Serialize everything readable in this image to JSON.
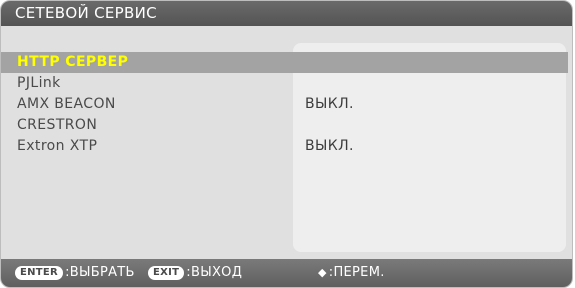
{
  "window": {
    "title": "СЕТЕВОЙ СЕРВИС"
  },
  "menu": {
    "items": [
      {
        "label": "HTTP СЕРВЕР",
        "value": "",
        "selected": true
      },
      {
        "label": "PJLink",
        "value": ""
      },
      {
        "label": "AMX BEACON",
        "value": "ВЫКЛ."
      },
      {
        "label": "CRESTRON",
        "value": ""
      },
      {
        "label": "Extron XTP",
        "value": "ВЫКЛ."
      }
    ]
  },
  "footer": {
    "enter_key": "ENTER",
    "enter_action": ":ВЫБРАТЬ",
    "exit_key": "EXIT",
    "exit_action": ":ВЫХОД",
    "move_icon": "up-down-arrows-icon",
    "move_action": ":ПЕРЕМ."
  },
  "colors": {
    "selected_text": "#ffff00",
    "selected_bg": "#a3a3a3",
    "titlebar_bg": "#5e5e5e"
  }
}
